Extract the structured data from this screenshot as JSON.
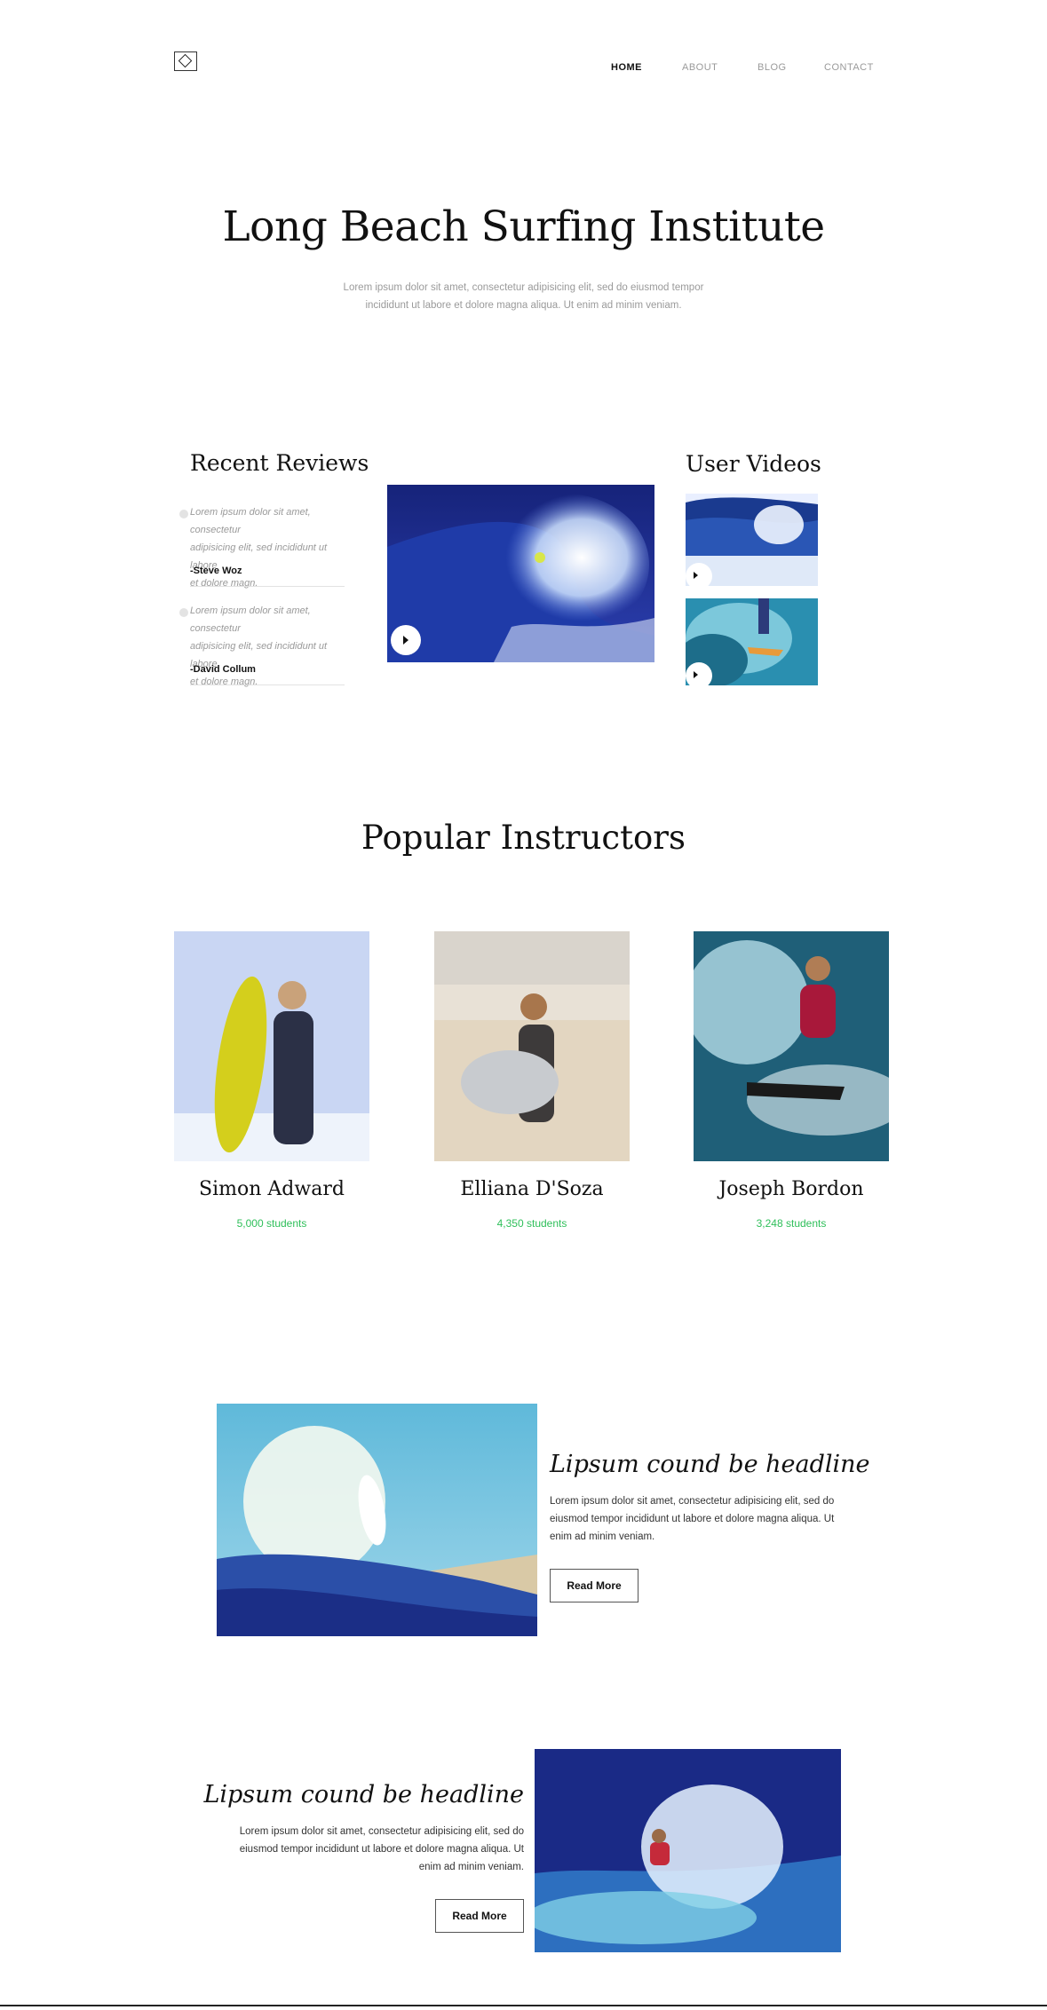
{
  "nav": {
    "items": [
      {
        "label": "HOME",
        "active": true
      },
      {
        "label": "ABOUT",
        "active": false
      },
      {
        "label": "BLOG",
        "active": false
      },
      {
        "label": "CONTACT",
        "active": false
      }
    ]
  },
  "hero": {
    "title": "Long Beach Surfing Institute",
    "subtitle_line1": "Lorem ipsum dolor sit amet, consectetur adipisicing elit, sed do eiusmod tempor",
    "subtitle_line2": "incididunt ut labore et dolore magna aliqua. Ut enim ad minim veniam."
  },
  "reviews": {
    "heading": "Recent Reviews",
    "items": [
      {
        "text_line1": "Lorem ipsum dolor sit amet, consectetur",
        "text_line2": "adipisicing elit, sed incididunt ut labore",
        "text_line3": "et dolore magn.",
        "author": "-Steve Woz"
      },
      {
        "text_line1": "Lorem ipsum dolor sit amet, consectetur",
        "text_line2": "adipisicing elit, sed incididunt ut labore",
        "text_line3": "et dolore magn.",
        "author": "-David Collum"
      }
    ]
  },
  "user_videos": {
    "heading": "User Videos"
  },
  "instructors": {
    "heading": "Popular Instructors",
    "items": [
      {
        "name": "Simon Adward",
        "students": "5,000 students"
      },
      {
        "name": "Elliana D'Soza",
        "students": "4,350 students"
      },
      {
        "name": "Joseph Bordon",
        "students": "3,248 students"
      }
    ]
  },
  "features": [
    {
      "headline": "Lipsum cound be headline",
      "line1": "Lorem ipsum dolor sit amet, consectetur adipisicing elit, sed do",
      "line2": "eiusmod tempor incididunt ut labore et dolore magna aliqua. Ut",
      "line3": "enim ad minim veniam.",
      "button": "Read More"
    },
    {
      "headline": "Lipsum cound be headline",
      "line1": "Lorem ipsum dolor sit amet, consectetur adipisicing elit, sed do",
      "line2": "eiusmod tempor incididunt ut labore et dolore magna aliqua. Ut",
      "line3": "enim ad minim veniam.",
      "button": "Read More"
    }
  ],
  "colors": {
    "accent_green": "#2fbf5a",
    "ocean_dark": "#1b2f8f",
    "ocean_light": "#3fa9d6"
  }
}
